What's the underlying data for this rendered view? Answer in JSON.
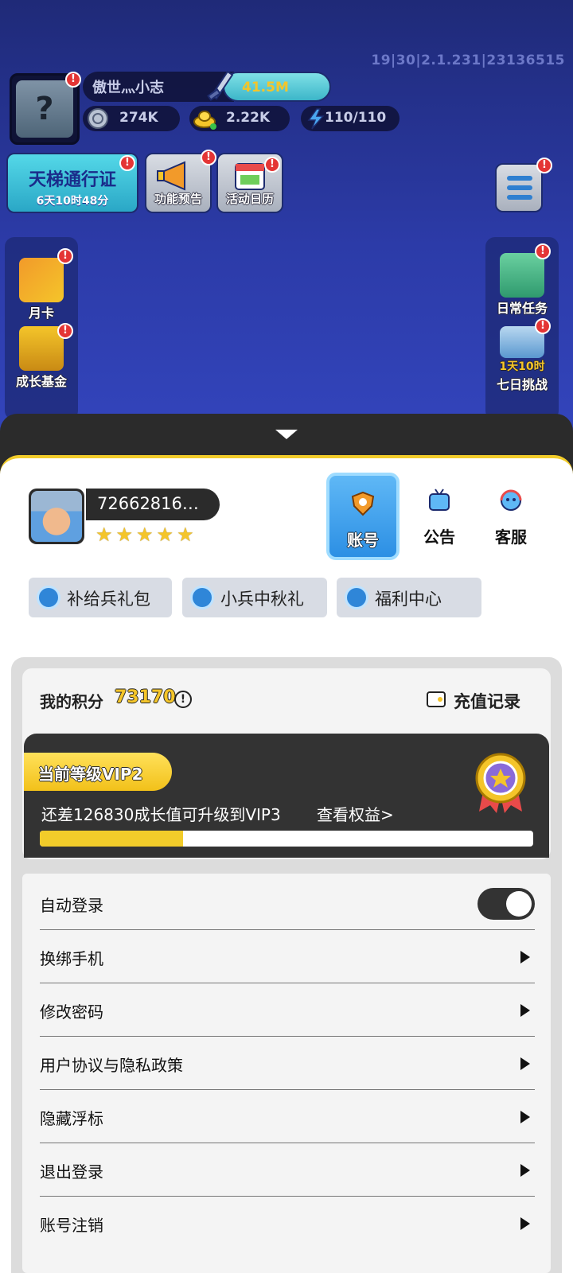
{
  "background": {
    "version": "19|30|2.1.231|23136515",
    "player_name": "傲世灬小志",
    "power": "41.5M",
    "resources": {
      "silver": "274K",
      "gold": "2.22K",
      "energy": "110/110"
    },
    "pass": {
      "title": "天梯通行证",
      "timer": "6天10时48分"
    },
    "top_buttons": [
      "功能预告",
      "活动日历"
    ],
    "left_side": [
      "月卡",
      "成长基金"
    ],
    "right_side": [
      {
        "label": "日常任务",
        "sub": ""
      },
      {
        "label": "七日挑战",
        "sub": "1天10时"
      }
    ],
    "badge": "!"
  },
  "sheet": {
    "user_id": "72662816…",
    "stars": 5,
    "star_glyph": "★",
    "tabs": [
      {
        "label": "账号",
        "active": true
      },
      {
        "label": "公告",
        "active": false
      },
      {
        "label": "客服",
        "active": false
      }
    ],
    "chips": [
      "补给兵礼包",
      "小兵中秋礼",
      "福利中心"
    ]
  },
  "points": {
    "label": "我的积分",
    "value": "73170",
    "recharge_label": "充值记录"
  },
  "vip": {
    "level_label": "当前等级VIP2",
    "tip": "还差126830成长值可升级到VIP3",
    "link": "查看权益>",
    "progress": 0.29
  },
  "settings": {
    "auto_login": {
      "label": "自动登录",
      "enabled": true
    },
    "items": [
      "换绑手机",
      "修改密码",
      "用户协议与隐私政策",
      "隐藏浮标",
      "退出登录",
      "账号注销"
    ]
  },
  "colors": {
    "accent_yellow": "#f2cc2a",
    "tab_active_blue": "#2c8fe4",
    "badge_red": "#e43535"
  }
}
